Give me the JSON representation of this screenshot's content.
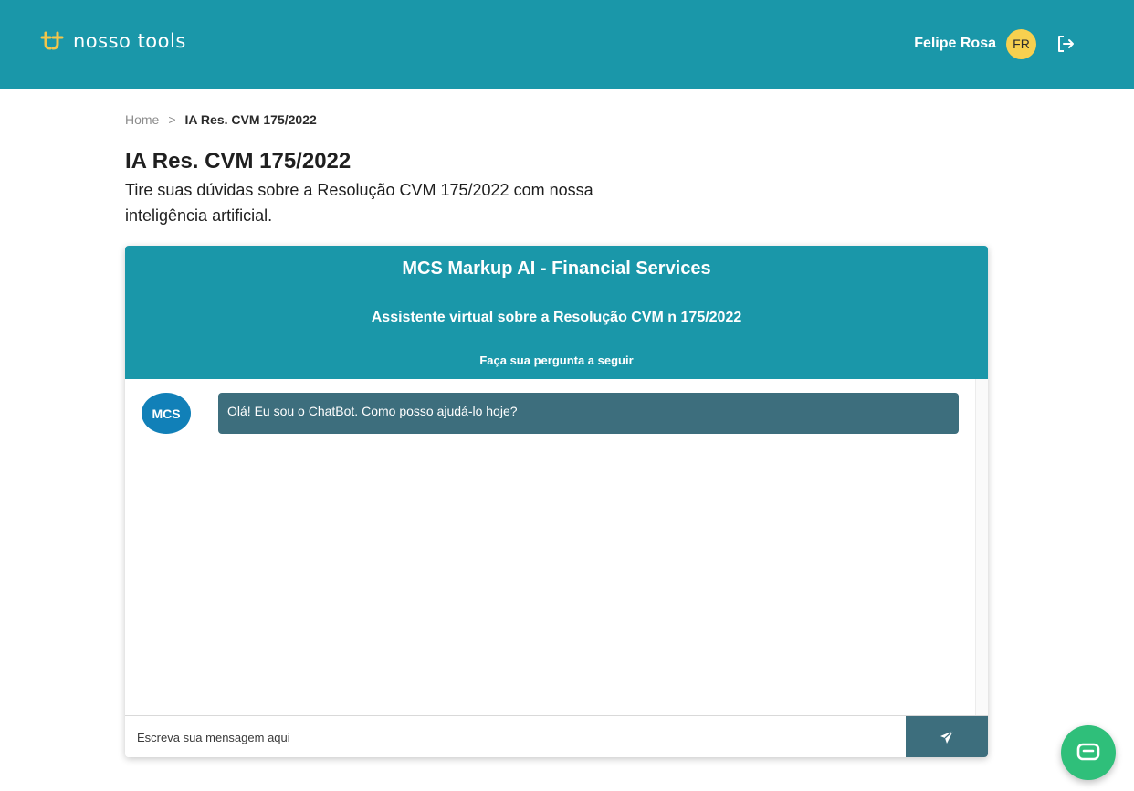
{
  "header": {
    "logo_text": "nosso tools",
    "user_name": "Felipe Rosa",
    "user_initials": "FR",
    "colors": {
      "bar": "#1a97a9",
      "avatar": "#f7d04f",
      "logo_mark": "#f3c64a"
    }
  },
  "breadcrumb": {
    "home": "Home",
    "separator": ">",
    "current": "IA Res. CVM 175/2022"
  },
  "page": {
    "title": "IA Res. CVM 175/2022",
    "description": "Tire suas dúvidas sobre a Resolução CVM 175/2022 com nossa inteligência artificial."
  },
  "chat": {
    "title": "MCS Markup AI - Financial Services",
    "subtitle": "Assistente virtual sobre a Resolução CVM n 175/2022",
    "prompt": "Faça sua pergunta a seguir",
    "messages": [
      {
        "sender": "MCS",
        "text": "Olá! Eu sou o ChatBot. Como posso ajudá-lo hoje?"
      }
    ],
    "input_placeholder": "Escreva sua mensagem aqui",
    "send_icon": "paper-plane-icon",
    "colors": {
      "header": "#1a97a9",
      "bubble": "#3d6e7d",
      "bot_avatar": "#1180b8",
      "send": "#3d6e7d"
    }
  },
  "help_widget": {
    "icon": "chat-bubble-icon",
    "color": "#2fbf7a"
  }
}
